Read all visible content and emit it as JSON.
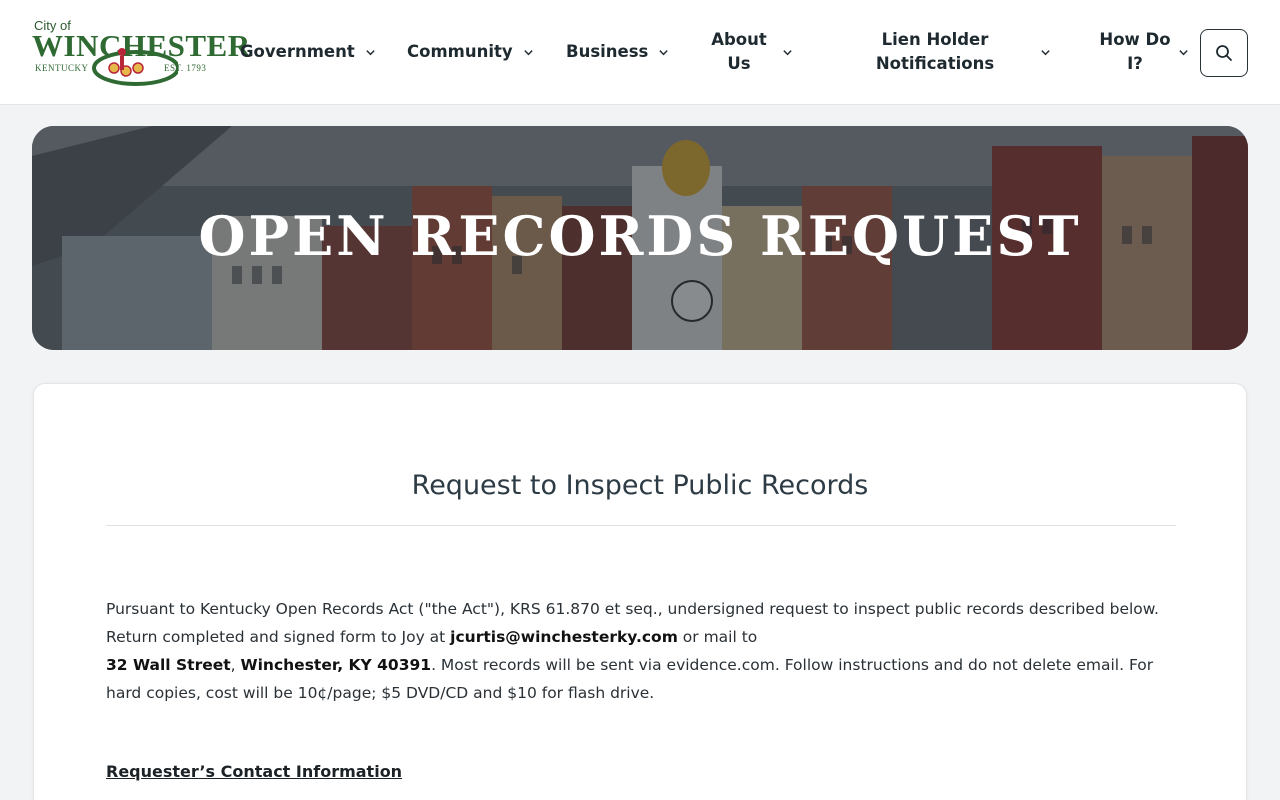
{
  "header": {
    "logo": {
      "city_of": "City of",
      "name": "WINCHESTER",
      "state": "KENTUCKY",
      "established": "EST. 1793"
    },
    "nav": [
      {
        "label": "Government"
      },
      {
        "label": "Community"
      },
      {
        "label": "Business"
      },
      {
        "label": "About Us"
      },
      {
        "label": "Lien Holder Notifications"
      },
      {
        "label": "How Do I?"
      }
    ],
    "search_icon": "search-icon"
  },
  "hero": {
    "title": "OPEN RECORDS REQUEST"
  },
  "content": {
    "title": "Request to Inspect Public Records",
    "intro_1": "Pursuant to Kentucky Open Records Act (\"the Act\"), KRS 61.870 et seq., undersigned request to inspect public records described below. Return completed and signed form to Joy at ",
    "email": "jcurtis@winchesterky.com",
    "intro_2": " or mail to",
    "street": "32 Wall Street",
    "comma": ", ",
    "city_zip": "Winchester, KY 40391",
    "intro_3": ". Most records will be sent via evidence.com. Follow instructions and do not delete email. For hard copies, cost will be 10¢/page; $5 DVD/CD and $10 for flash drive.",
    "section_heading": "Requester’s Contact Information"
  },
  "colors": {
    "brand_green": "#2f6a33",
    "accent_red": "#b8263a",
    "text_dark": "#1f2a30"
  }
}
